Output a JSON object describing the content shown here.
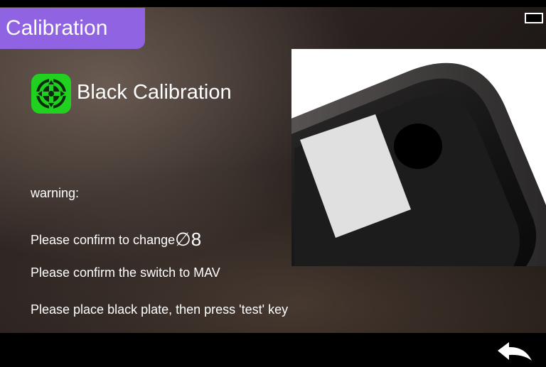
{
  "header": {
    "title": "Calibration"
  },
  "calibration": {
    "heading": "Black Calibration",
    "icon": "calibration-target-icon",
    "icon_color": "#22dd22"
  },
  "messages": {
    "warning": "warning:",
    "confirm_aperture_prefix": "Please confirm to change",
    "confirm_aperture_value": "∅8",
    "confirm_switch": "Please confirm the switch to  MAV",
    "instruction": "Please place black plate, then press 'test' key"
  },
  "colors": {
    "title_tab": "#8f63e2",
    "text": "#ffffff",
    "bars": "#000000"
  },
  "icons": {
    "battery": "battery-icon",
    "back": "back-arrow-icon"
  }
}
